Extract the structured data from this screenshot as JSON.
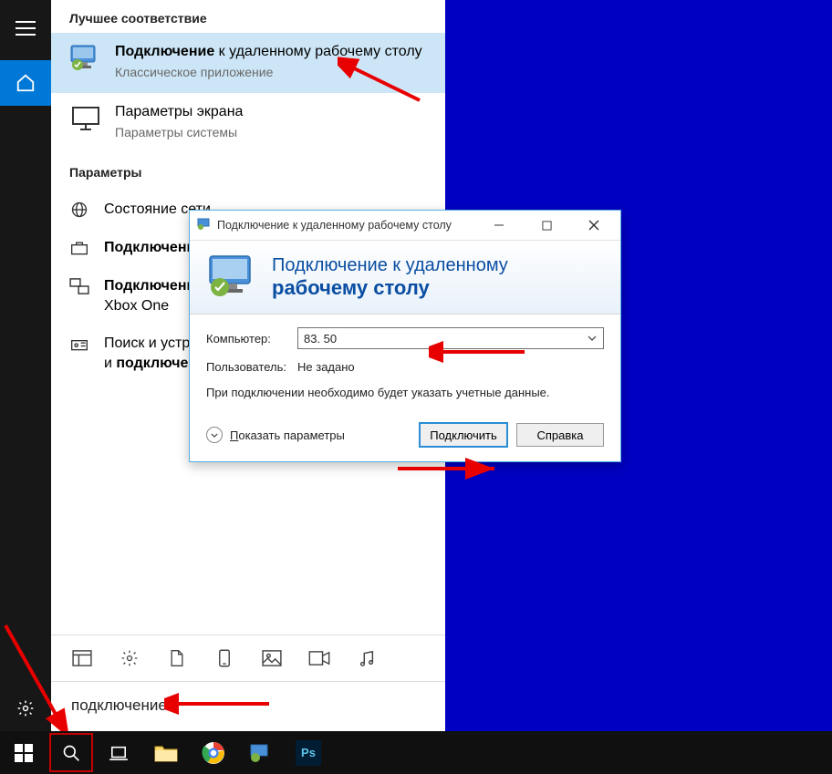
{
  "rail": {
    "hamburger": "≡",
    "home": "⌂",
    "settings": "⚙"
  },
  "start": {
    "best_match_header": "Лучшее соответствие",
    "best_match": {
      "title_bold": "Подключение",
      "title_rest": " к удаленному рабочему столу",
      "subtitle": "Классическое приложение"
    },
    "display_params": {
      "title": "Параметры экрана",
      "subtitle": "Параметры системы"
    },
    "params_header": "Параметры",
    "params": [
      {
        "icon": "globe",
        "text_plain": "Состояние сети"
      },
      {
        "icon": "briefcase",
        "text_bold": "Подключение"
      },
      {
        "icon": "cast",
        "text_bold": "Подключение",
        "text_rest": "",
        "line2_plain": "Xbox One"
      },
      {
        "icon": "radio",
        "text_plain_pre": "Поиск и устранение",
        "line2_plain_pre": "и ",
        "line2_bold": "подключени"
      }
    ],
    "bottom_icons": [
      "layout",
      "gear",
      "doc",
      "phone",
      "image",
      "video",
      "music"
    ],
    "search_value": "подключение"
  },
  "dialog": {
    "title": "Подключение к удаленному рабочему столу",
    "banner_line1": "Подключение к удаленному",
    "banner_line2": "рабочему столу",
    "label_computer": "Компьютер:",
    "computer_value": "83.                  50",
    "label_user": "Пользователь:",
    "user_value": "Не задано",
    "note": "При подключении необходимо будет указать учетные данные.",
    "show_options": "Показать параметры",
    "connect": "Подключить",
    "help": "Справка"
  },
  "taskbar": {
    "apps": [
      "start",
      "search",
      "taskview",
      "explorer",
      "chrome",
      "rdp",
      "photoshop"
    ]
  }
}
